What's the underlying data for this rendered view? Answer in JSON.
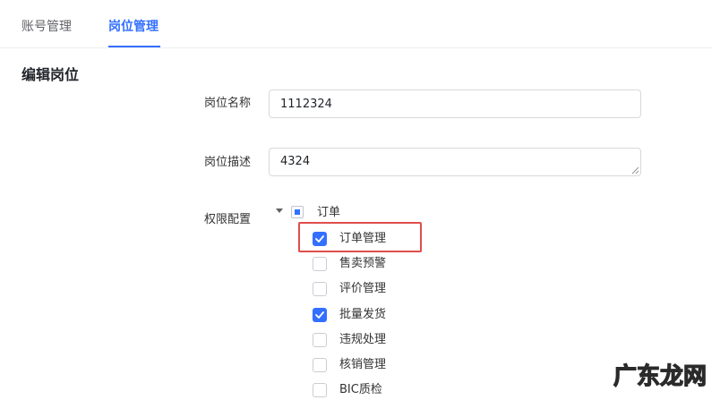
{
  "tabs": [
    {
      "label": "账号管理",
      "active": false
    },
    {
      "label": "岗位管理",
      "active": true
    }
  ],
  "section": {
    "title": "编辑岗位"
  },
  "form": {
    "name": {
      "label": "岗位名称",
      "value": "1112324"
    },
    "desc": {
      "label": "岗位描述",
      "value": "4324"
    },
    "perm": {
      "label": "权限配置"
    }
  },
  "tree": {
    "parent": {
      "label": "订单",
      "state": "indeterminate"
    },
    "children": [
      {
        "label": "订单管理",
        "checked": true
      },
      {
        "label": "售卖预警",
        "checked": false
      },
      {
        "label": "评价管理",
        "checked": false
      },
      {
        "label": "批量发货",
        "checked": true
      },
      {
        "label": "违规处理",
        "checked": false
      },
      {
        "label": "核销管理",
        "checked": false
      },
      {
        "label": "BIC质检",
        "checked": false
      }
    ]
  },
  "colors": {
    "accent": "#3370ff",
    "highlight": "#e04d4d"
  },
  "watermark": {
    "text": "广东龙网"
  }
}
